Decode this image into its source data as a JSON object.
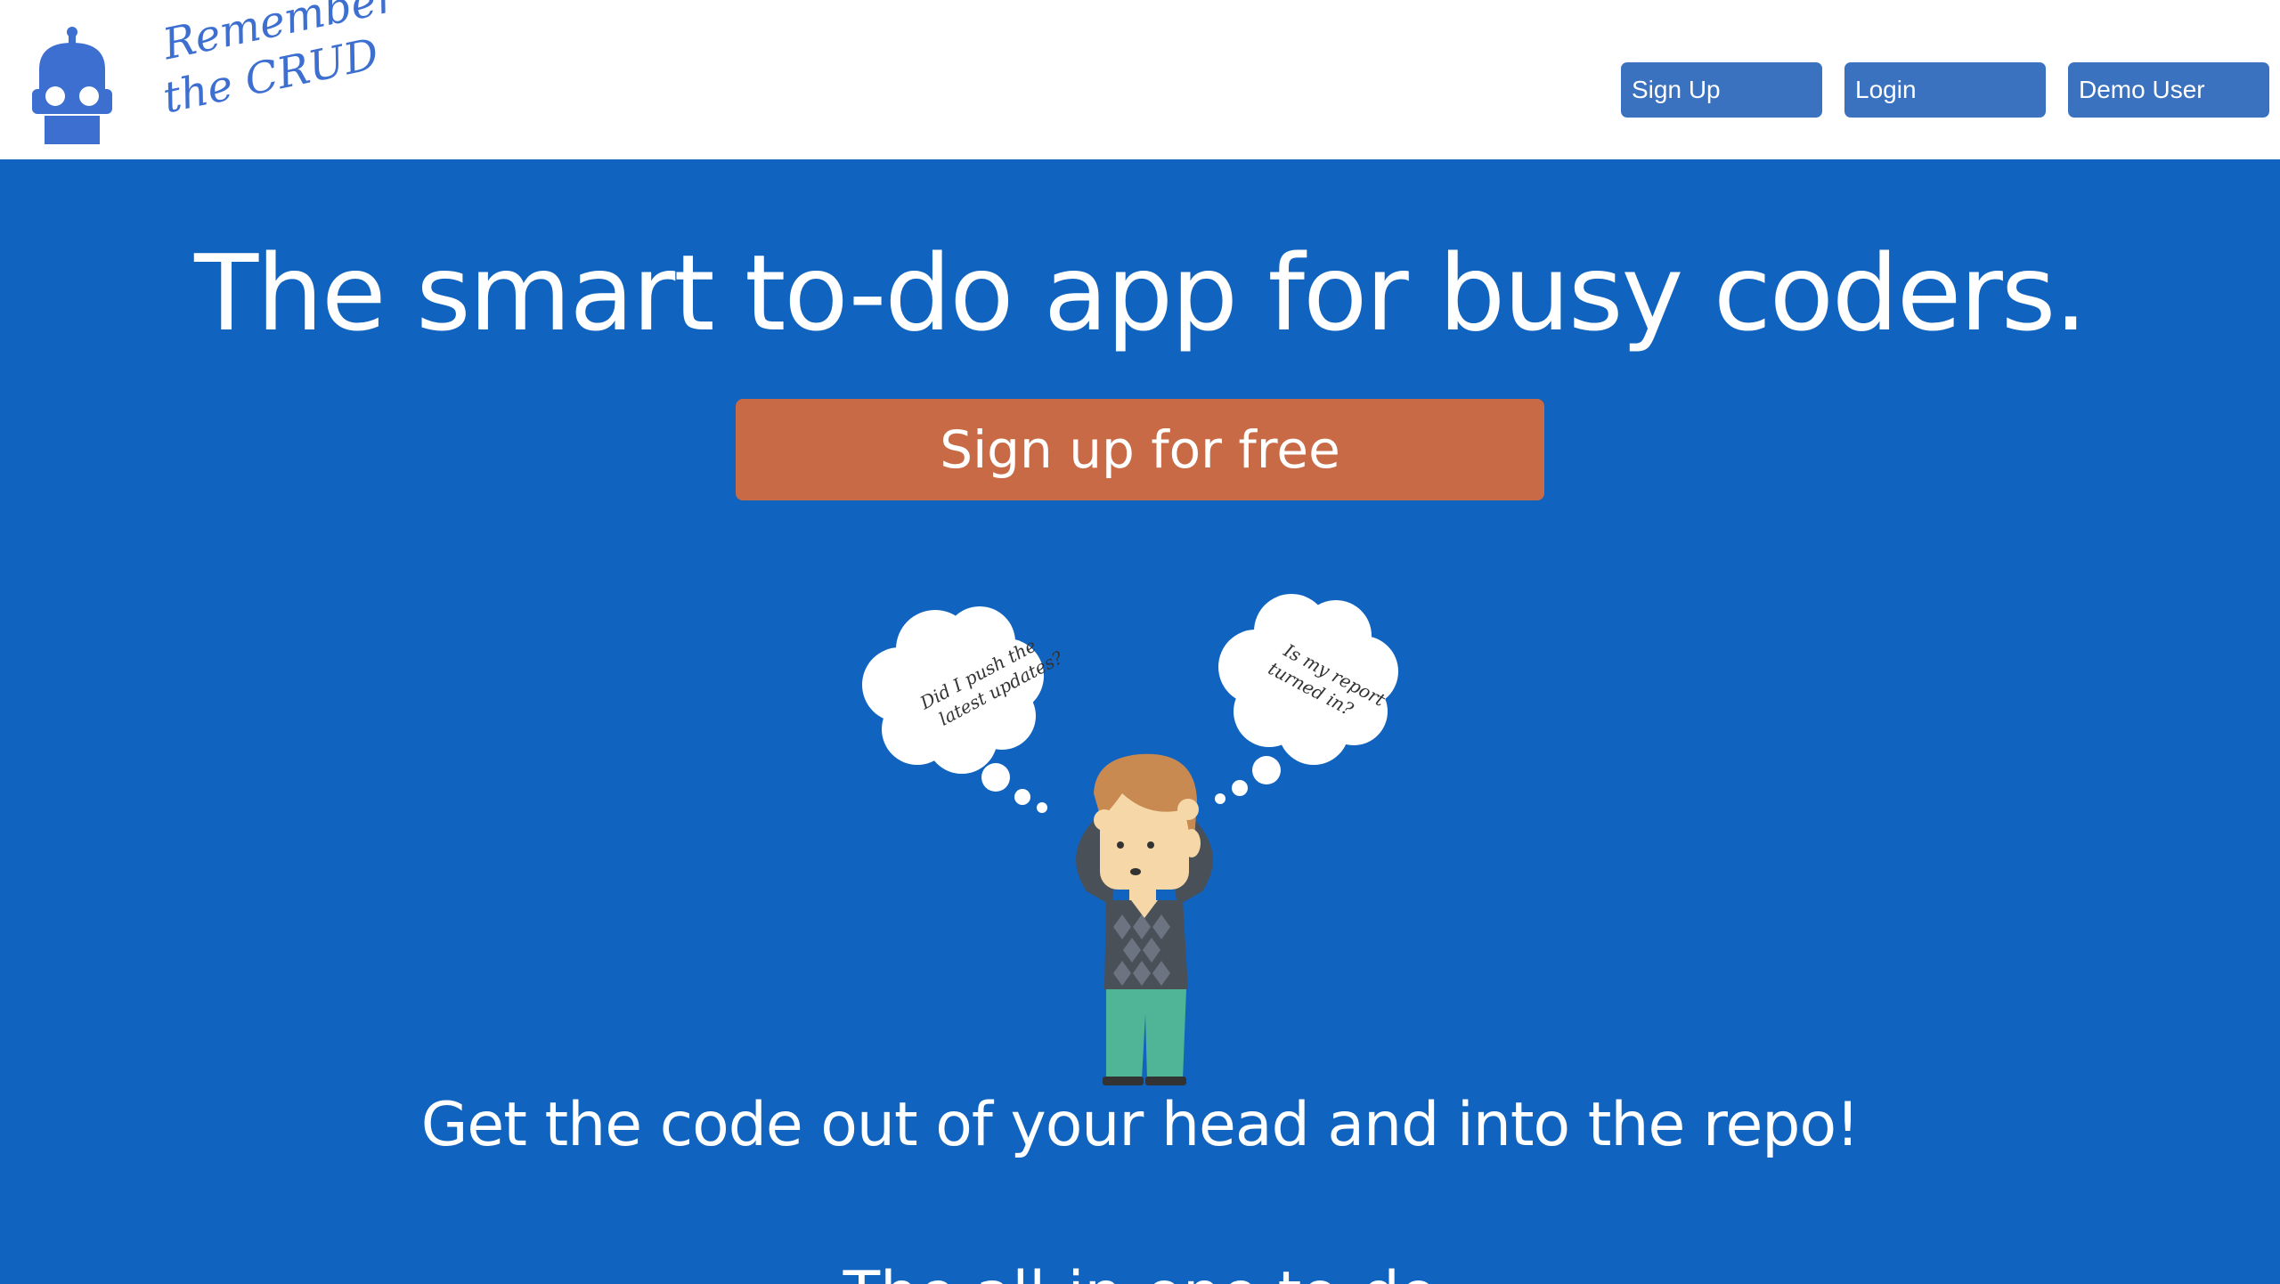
{
  "brand": {
    "name_line1": "Remember",
    "name_line2": "the CRUD",
    "icon": "robot-icon",
    "color": "#3d6fd1"
  },
  "nav": {
    "signup_label": "Sign Up",
    "login_label": "Login",
    "demo_label": "Demo User",
    "button_color": "#3a72c0"
  },
  "hero": {
    "background": "#1063bf",
    "headline": "The smart to-do app for busy coders.",
    "cta_label": "Sign up for free",
    "cta_color": "#c76a45",
    "thought_left": [
      "Did I push the",
      "latest updates?"
    ],
    "thought_right": [
      "Is my report",
      "turned in?"
    ],
    "tagline": "Get the code out of your head and into the repo!",
    "subhead": "The all-in-one to-do"
  }
}
